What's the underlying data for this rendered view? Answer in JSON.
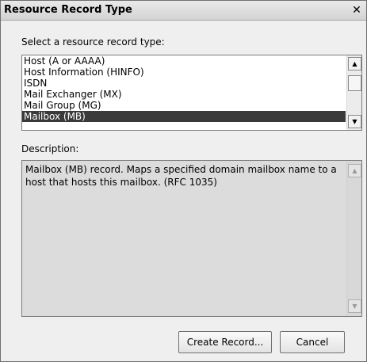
{
  "window": {
    "title": "Resource Record Type",
    "close_glyph": "✕"
  },
  "select_label": "Select a resource record type:",
  "record_types": [
    {
      "label": "Host (A or AAAA)",
      "selected": false
    },
    {
      "label": "Host Information (HINFO)",
      "selected": false
    },
    {
      "label": "ISDN",
      "selected": false
    },
    {
      "label": "Mail Exchanger (MX)",
      "selected": false
    },
    {
      "label": "Mail Group (MG)",
      "selected": false
    },
    {
      "label": "Mailbox (MB)",
      "selected": true
    }
  ],
  "description_label": "Description:",
  "description_text": "Mailbox (MB) record. Maps a specified domain mailbox name to a host that hosts this mailbox. (RFC 1035)",
  "buttons": {
    "create": "Create Record...",
    "cancel": "Cancel"
  },
  "icons": {
    "scroll_up": "▲",
    "scroll_down": "▼"
  },
  "colors": {
    "selection": "#3a3a3a",
    "window_bg": "#efefef",
    "description_bg": "#dcdcdc"
  }
}
